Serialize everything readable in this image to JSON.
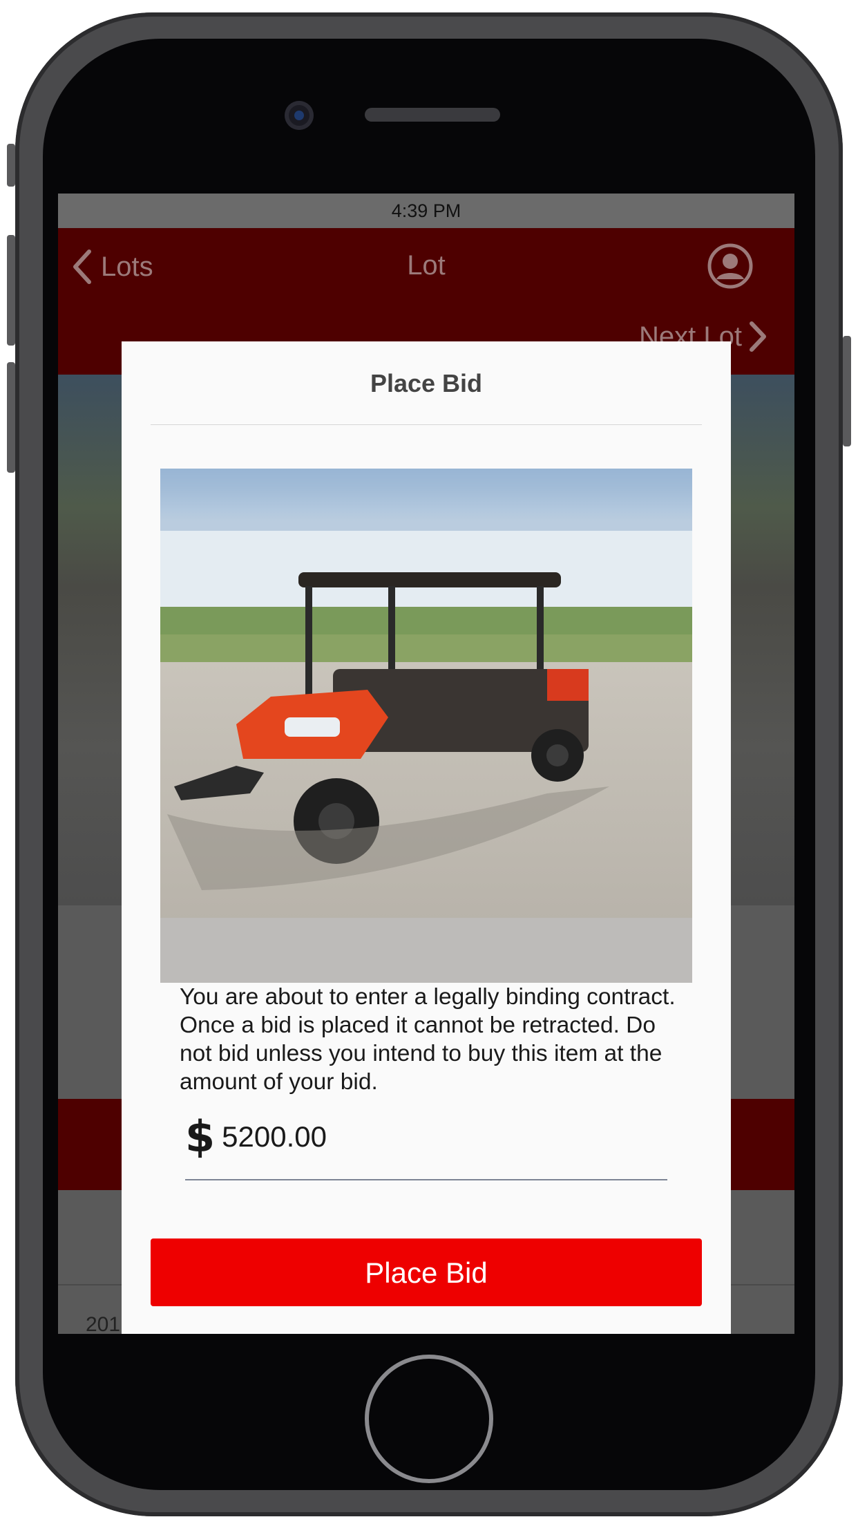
{
  "status_bar": {
    "time": "4:39 PM"
  },
  "nav": {
    "back_label": "Lots",
    "title": "Lot",
    "next_label": "Next Lot",
    "icons": {
      "back": "chevron-left-icon",
      "user": "user-circle-icon",
      "next": "chevron-right-icon"
    }
  },
  "background": {
    "partial_text": "201"
  },
  "modal": {
    "title": "Place Bid",
    "image_alt": "utility-vehicle-photo",
    "disclaimer": "You are about to enter a legally binding contract. Once a bid is placed it cannot be retracted. Do not bid unless you intend to buy this item at the amount of your bid.",
    "currency_symbol": "$",
    "bid_amount": "5200.00",
    "submit_label": "Place Bid"
  },
  "colors": {
    "accent_red": "#ee0000",
    "nav_dark_red": "#4e0000"
  }
}
